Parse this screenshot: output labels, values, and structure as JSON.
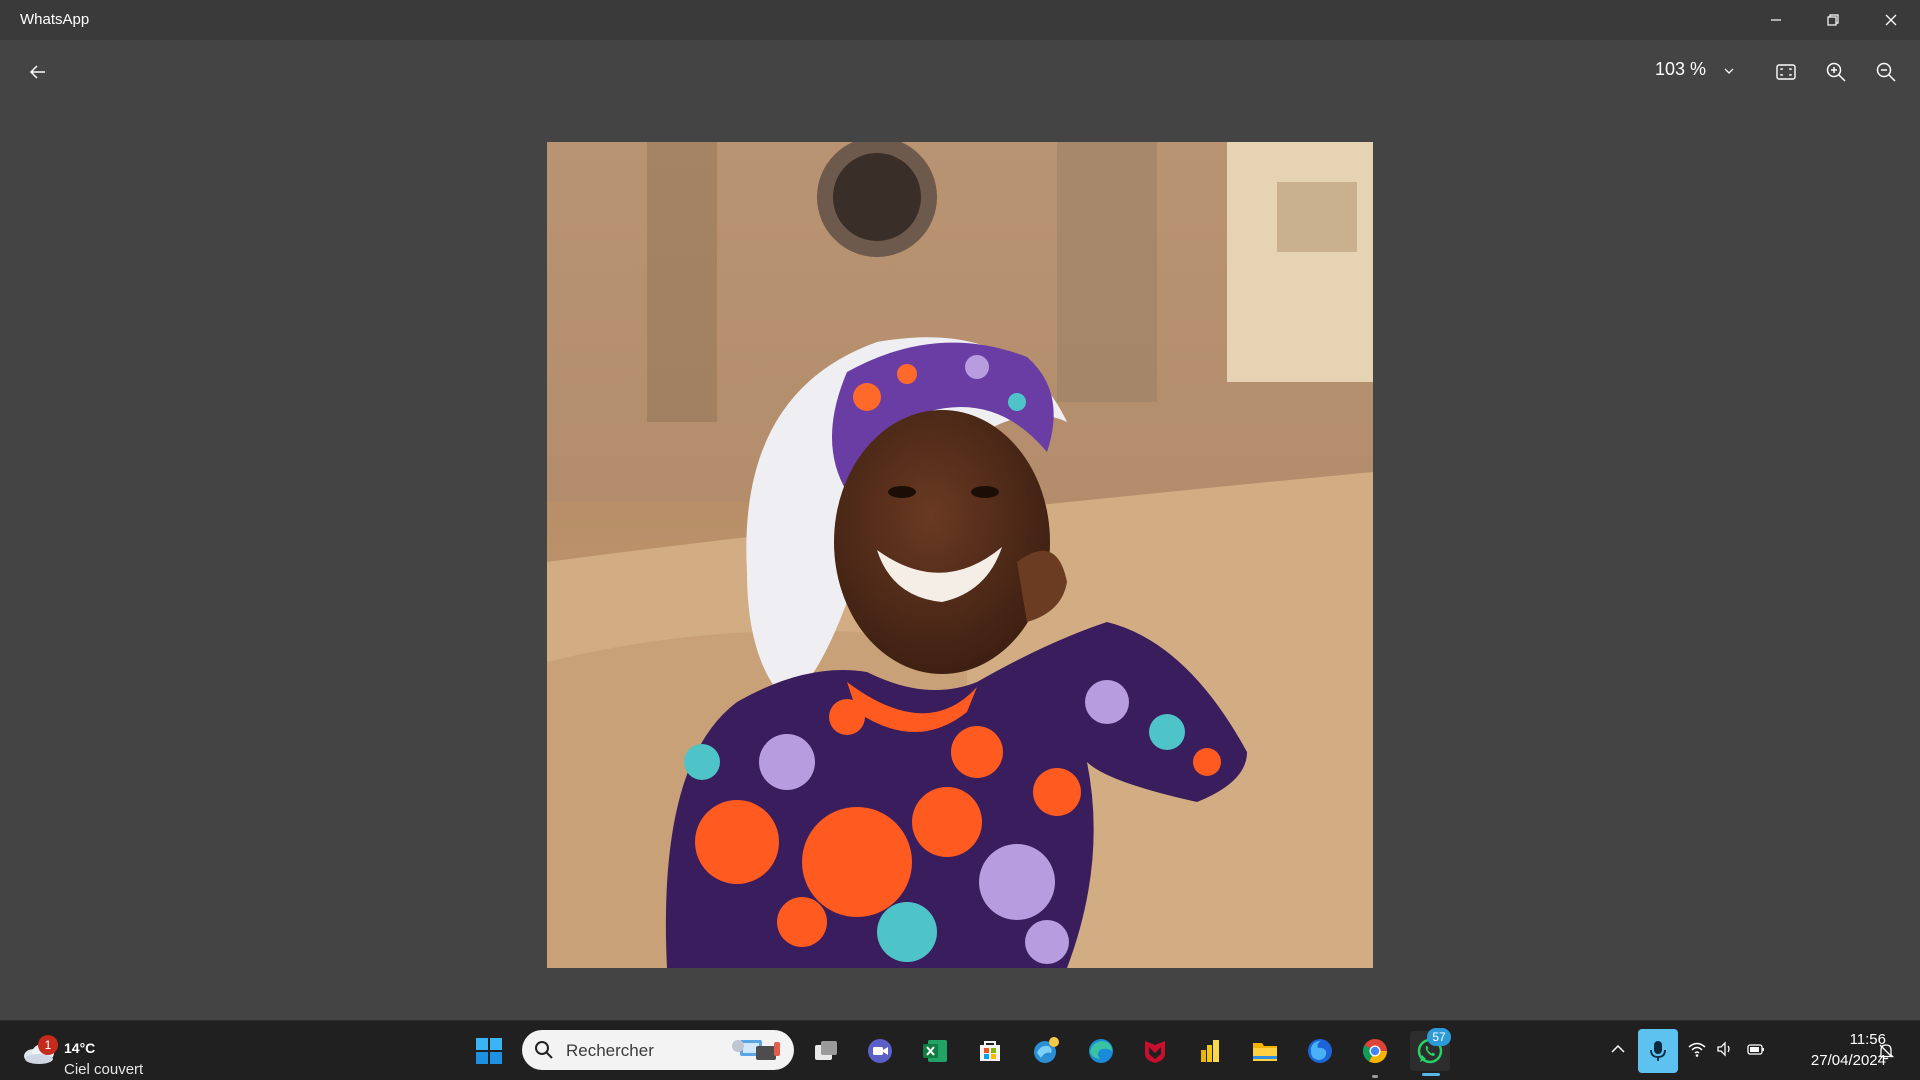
{
  "window": {
    "title": "WhatsApp",
    "controls": {
      "minimize": "minimize-icon",
      "restore": "restore-icon",
      "close": "close-icon"
    }
  },
  "viewer": {
    "back_icon": "arrow-left-icon",
    "zoom_level": "103 %",
    "zoom_dropdown_icon": "chevron-down-icon",
    "fit_icon": "fit-to-window-icon",
    "zoom_in_icon": "zoom-in-icon",
    "zoom_out_icon": "zoom-out-icon",
    "photo": "portrait-photo"
  },
  "taskbar": {
    "weather": {
      "temp": "14°C",
      "desc": "Ciel couvert",
      "badge": "1",
      "icon": "cloud-icon"
    },
    "search": {
      "placeholder": "Rechercher"
    },
    "apps": [
      {
        "name": "start",
        "icon": "windows-logo-icon"
      },
      {
        "name": "task-view",
        "icon": "task-view-icon"
      },
      {
        "name": "meet",
        "icon": "video-chat-icon"
      },
      {
        "name": "excel",
        "icon": "excel-icon"
      },
      {
        "name": "store",
        "icon": "store-icon"
      },
      {
        "name": "edge-beta",
        "icon": "edge-beta-icon"
      },
      {
        "name": "edge",
        "icon": "edge-icon"
      },
      {
        "name": "mcafee",
        "icon": "shield-icon"
      },
      {
        "name": "power-bi",
        "icon": "chart-bars-icon"
      },
      {
        "name": "file-explorer",
        "icon": "folder-icon"
      },
      {
        "name": "firefox",
        "icon": "firefox-icon"
      },
      {
        "name": "chrome",
        "icon": "chrome-icon"
      },
      {
        "name": "whatsapp",
        "icon": "whatsapp-icon",
        "badge": "57"
      }
    ],
    "tray": {
      "chevron_icon": "chevron-up-icon",
      "mic_icon": "microphone-icon",
      "wifi_icon": "wifi-icon",
      "volume_icon": "volume-icon",
      "battery_icon": "battery-icon",
      "time": "11:56",
      "date": "27/04/2024",
      "notification_icon": "notification-icon"
    }
  },
  "colors": {
    "viewer_bg": "#444444",
    "titlebar_bg": "#3a3a3a",
    "taskbar_bg": "#202020",
    "accent": "#59b5e6"
  }
}
